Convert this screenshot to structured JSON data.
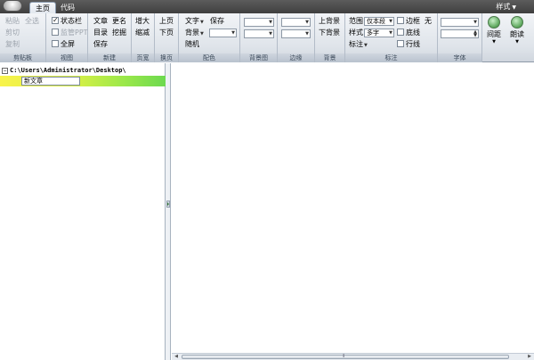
{
  "tabs": {
    "home": "主页",
    "code": "代码"
  },
  "style_menu": "样式",
  "groups": {
    "clipboard": {
      "label": "剪贴板",
      "paste": "粘贴",
      "select_all": "全选",
      "cut": "剪切",
      "copy": "复制"
    },
    "view": {
      "label": "视图",
      "status_bar": "状态栏",
      "status_bar_checked": true,
      "monitor_ppt": "监管PPT",
      "fullscreen": "全屏"
    },
    "new": {
      "label": "新建",
      "article": "文章",
      "rename": "更名",
      "catalog": "目录",
      "dig_out": "挖掘",
      "save": "保存"
    },
    "width": {
      "label": "页宽",
      "increase": "增大",
      "decrease": "缩减"
    },
    "page": {
      "label": "换页",
      "prev": "上页",
      "next": "下页"
    },
    "color": {
      "label": "配色",
      "text": "文字",
      "save": "保存",
      "background": "背景",
      "random": "随机"
    },
    "bg_image": {
      "label": "背景图"
    },
    "margin": {
      "label": "边缘"
    },
    "background": {
      "label": "背景",
      "prev_bg": "上背景",
      "next_bg": "下背景"
    },
    "annotation": {
      "label": "标注",
      "range": "范围",
      "range_value": "仅本段",
      "style": "样式",
      "style_value": "多字",
      "annotate": "标注",
      "border": "边框",
      "none": "无",
      "underline": "底线",
      "line": "行线"
    },
    "font": {
      "label": "字体"
    },
    "spacing_button": "间距",
    "read_button": "朗读"
  },
  "tree": {
    "root_path": "C:\\Users\\Administrator\\Desktop\\",
    "node_edit_value": "新文章"
  },
  "colors": {
    "ribbon_accent": "#8a9bb0",
    "title_bar": "#4b4b4b",
    "node_highlight": "#c8ee46"
  }
}
